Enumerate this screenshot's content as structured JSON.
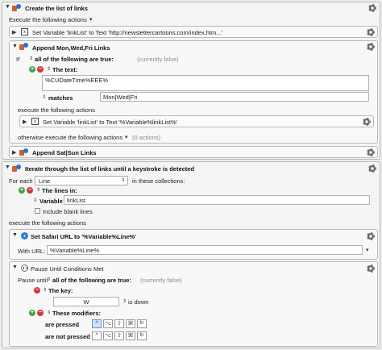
{
  "group1": {
    "title": "Create the list of links",
    "exec_label": "Execute the following actions",
    "action1": "Set Variable 'linkList' to Text 'http://newslettercartoons.com/index.htm...'",
    "if_block": {
      "title": "Append Mon,Wed,Fri Links",
      "if_label": "If",
      "condition_popup": "all of the following are true:",
      "status": "(currently false)",
      "text_label": "The text:",
      "text_value": "%CUDateTime%EEE%",
      "matches_label": "matches",
      "matches_value": "Mon|Wed|Fri",
      "exec_label": "execute the following actions",
      "inner_action": "Set Variable 'linkList' to Text '%Variable%linkList%'",
      "otherwise_label": "otherwise execute the following actions",
      "otherwise_count": "(0 actions)"
    },
    "action3": "Append Sat|Sun Links"
  },
  "group2": {
    "title": "Iterate through the list of links until a keystroke is detected",
    "for_each_label": "For each",
    "for_each_value": "Line",
    "in_collections": "in these collections:",
    "lines_in_label": "The lines in:",
    "variable_label": "Variable",
    "variable_value": "linkList",
    "blank_lines_label": "Include blank lines",
    "exec_label": "execute the following actions",
    "safari": {
      "title": "Set Safari URL to '%Variable%Line%'",
      "with_url_label": "With URL:",
      "with_url_value": "%Variable%Line%"
    },
    "pause": {
      "title": "Pause Until Conditions Met",
      "pause_until_label": "Pause until",
      "condition_popup": "all of the following are true:",
      "status": "(currently false)",
      "key_label": "The key:",
      "key_value": "W",
      "is_down": "is down",
      "modifiers_label": "These modifiers:",
      "are_pressed": "are pressed",
      "are_not_pressed": "are not pressed",
      "modifiers": [
        "^",
        "⌥",
        "⇧",
        "⌘",
        "fn"
      ]
    }
  },
  "icons": {
    "gear": "gear-icon",
    "add": "plus-icon",
    "remove": "minus-icon"
  }
}
